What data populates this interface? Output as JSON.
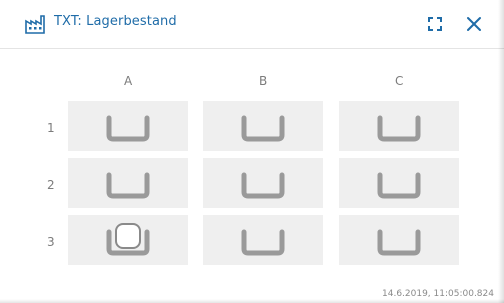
{
  "window": {
    "title": "TXT: Lagerbestand",
    "title_color": "#1f6ca8",
    "icons": {
      "app": "factory-icon",
      "expand": "fullscreen-icon",
      "close": "close-icon"
    }
  },
  "grid": {
    "columns": [
      "A",
      "B",
      "C"
    ],
    "rows": [
      "1",
      "2",
      "3"
    ],
    "cells": [
      {
        "id": "A1",
        "state": "empty"
      },
      {
        "id": "B1",
        "state": "empty"
      },
      {
        "id": "C1",
        "state": "empty"
      },
      {
        "id": "A2",
        "state": "empty"
      },
      {
        "id": "B2",
        "state": "empty"
      },
      {
        "id": "C2",
        "state": "empty"
      },
      {
        "id": "A3",
        "state": "occupied"
      },
      {
        "id": "B3",
        "state": "empty"
      },
      {
        "id": "C3",
        "state": "empty"
      }
    ]
  },
  "timestamp": "14.6.2019, 11:05:00.824"
}
